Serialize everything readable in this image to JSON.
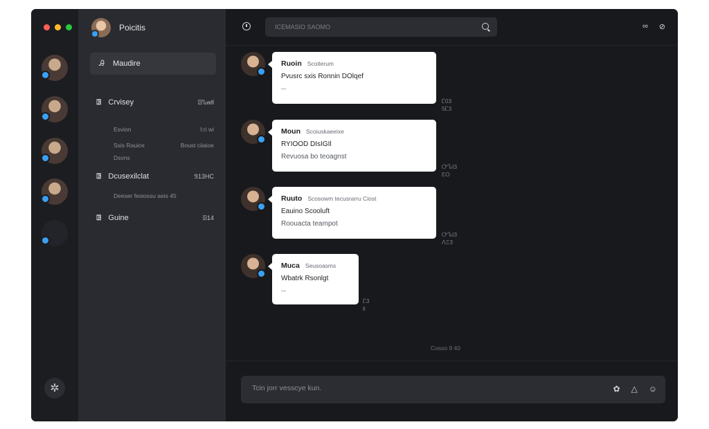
{
  "window": {
    "controls": {
      "close": "#ff5f57",
      "minimize": "#febc2e",
      "maximize": "#28c840"
    }
  },
  "rail": {
    "avatars": [
      {
        "name": "avatar-1"
      },
      {
        "name": "avatar-2"
      },
      {
        "name": "avatar-3"
      },
      {
        "name": "avatar-4"
      },
      {
        "name": "avatar-5"
      }
    ],
    "settings_icon": "settings-icon"
  },
  "panel": {
    "title": "Poicitis",
    "active_item": {
      "icon": "Ꭿ",
      "label": "Maudire"
    },
    "groups": [
      {
        "hash": "ꖸ",
        "label": "Crvisey",
        "count": "ꖸᏖwll",
        "sub": [
          {
            "left": "Esvion",
            "right": "I:ri wi"
          },
          {
            "left": "Ssis Rauice",
            "right": "Boust ciiaioe"
          },
          {
            "left": "Dsvns",
            "right": ""
          }
        ]
      },
      {
        "hash": "ꖸ",
        "label": "Dcusexilclat",
        "count": "Ꮥ13HC",
        "sub": [
          {
            "left": "Deeser fesiossu aeis 45",
            "right": ""
          }
        ]
      },
      {
        "hash": "ꖸ",
        "label": "Guine",
        "count": "ꖸ14",
        "sub": []
      }
    ]
  },
  "chat": {
    "search_placeholder": "ICEMASIO SAOMO",
    "top_icons": [
      "link-icon",
      "bell-icon"
    ],
    "messages": [
      {
        "name": "Ruoin",
        "sub": "Scoiterum",
        "lines": [
          "Pvusrc sxis Ronnin DOlqef"
        ],
        "small": "—",
        "time": "Ꮭ03 5Ꮭ3"
      },
      {
        "name": "Moun",
        "sub": "Scoiuskaeeixe",
        "lines": [
          "RYIOOD DIsIGIl",
          "Revuosa bo teoagnst"
        ],
        "small": "",
        "time": "ᏅᏖI3 ƐO"
      },
      {
        "name": "Ruuto",
        "sub": "Scosowm tecusrarru Ciost",
        "lines": [
          "Eauino Scooluft",
          "Roouacta teampot"
        ],
        "small": "",
        "time": "ᏅᏖI3 ΛΞ3"
      },
      {
        "name": "Muca",
        "sub": "Seusoasms",
        "lines": [
          "Wbatrk Rsonlgt"
        ],
        "small": "—",
        "time": "Ꮭ3 Ꭵl"
      }
    ],
    "footer_timestamp": "Cosso 9 40",
    "composer_placeholder": "Tcin jorr vesscye kun.",
    "composer_icons": [
      "attach-icon",
      "image-icon",
      "emoji-icon"
    ]
  }
}
